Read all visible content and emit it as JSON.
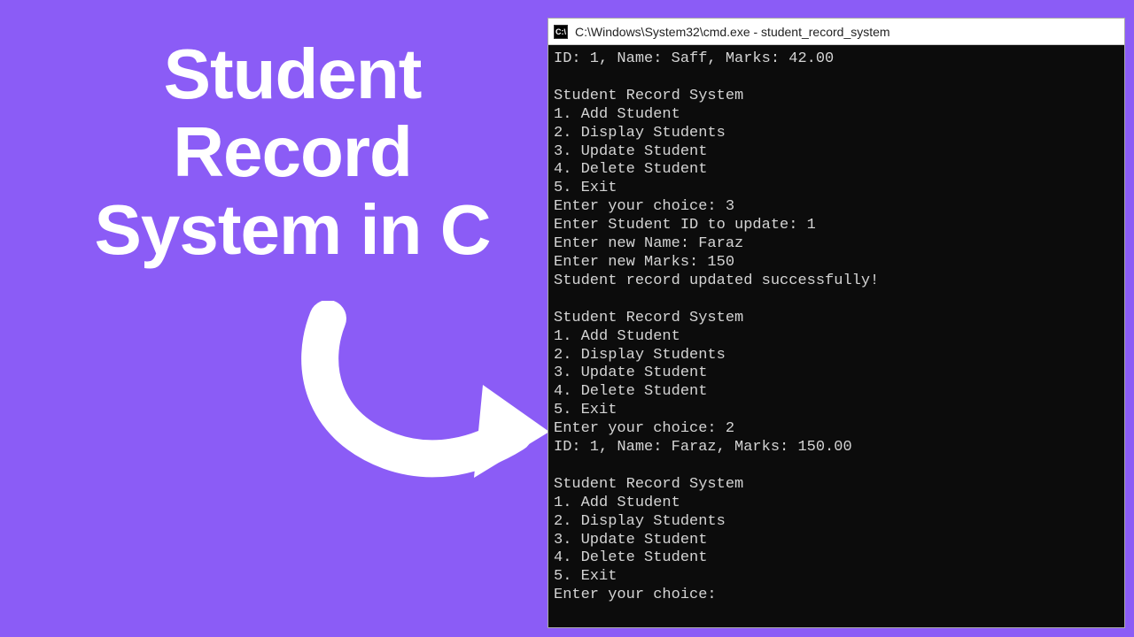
{
  "heading": "Student Record System in C",
  "window": {
    "title_path": "C:\\Windows\\System32\\cmd.exe - student_record_system",
    "icon_text": "C:\\"
  },
  "terminal_lines": [
    "ID: 1, Name: Saff, Marks: 42.00",
    "",
    "Student Record System",
    "1. Add Student",
    "2. Display Students",
    "3. Update Student",
    "4. Delete Student",
    "5. Exit",
    "Enter your choice: 3",
    "Enter Student ID to update: 1",
    "Enter new Name: Faraz",
    "Enter new Marks: 150",
    "Student record updated successfully!",
    "",
    "Student Record System",
    "1. Add Student",
    "2. Display Students",
    "3. Update Student",
    "4. Delete Student",
    "5. Exit",
    "Enter your choice: 2",
    "ID: 1, Name: Faraz, Marks: 150.00",
    "",
    "Student Record System",
    "1. Add Student",
    "2. Display Students",
    "3. Update Student",
    "4. Delete Student",
    "5. Exit",
    "Enter your choice:"
  ]
}
